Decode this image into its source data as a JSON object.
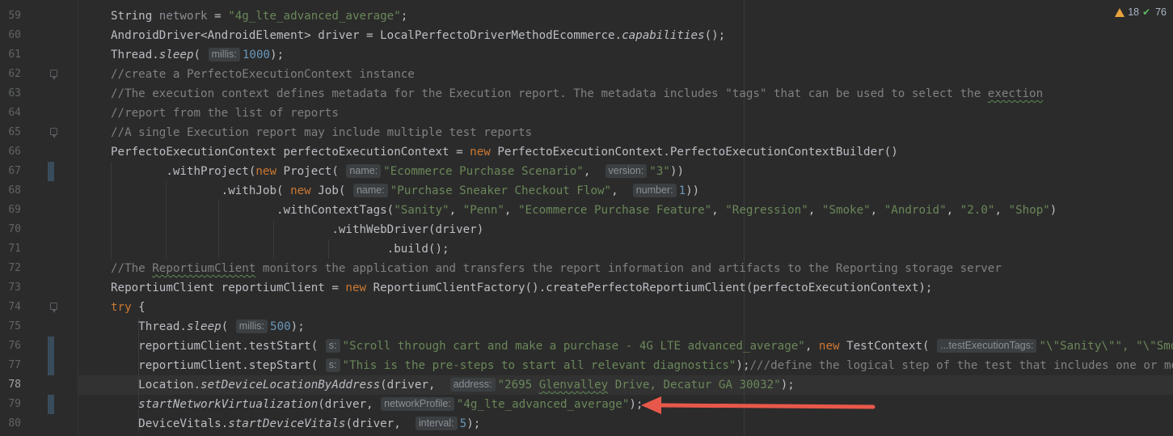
{
  "colors": {
    "keyword": "#cc7832",
    "string": "#6a8759",
    "number": "#6897bb",
    "comment": "#808080",
    "arrow": "#e8584a"
  },
  "inspections": {
    "warning_icon": "warning-triangle-icon",
    "warnings": "18",
    "check_icon": "double-check-icon",
    "passed": "76"
  },
  "current_line": 78,
  "lines": [
    {
      "n": 59,
      "tokens": [
        [
          "t",
          "String "
        ],
        [
          "dim",
          "network"
        ],
        [
          "t",
          " = "
        ],
        [
          "str",
          "\"4g_lte_advanced_average\""
        ],
        [
          "t",
          ";"
        ]
      ]
    },
    {
      "n": 60,
      "tokens": [
        [
          "t",
          "AndroidDriver<AndroidElement> driver = LocalPerfectoDriverMethodEcommerce."
        ],
        [
          "it",
          "capabilities"
        ],
        [
          "t",
          "();"
        ]
      ]
    },
    {
      "n": 61,
      "tokens": [
        [
          "t",
          "Thread."
        ],
        [
          "it",
          "sleep"
        ],
        [
          "t",
          "( "
        ],
        [
          "hint",
          "millis:"
        ],
        [
          "num",
          "1000"
        ],
        [
          "t",
          ");"
        ]
      ]
    },
    {
      "n": 62,
      "tokens": [
        [
          "cm",
          "//create a PerfectoExecutionContext instance"
        ]
      ]
    },
    {
      "n": 63,
      "tokens": [
        [
          "cm",
          "//The execution context defines metadata for the Execution report. The metadata includes \"tags\" that can be used to select the "
        ],
        [
          "cmtypo",
          "exection"
        ]
      ]
    },
    {
      "n": 64,
      "tokens": [
        [
          "cm",
          "//report from the list of reports"
        ]
      ]
    },
    {
      "n": 65,
      "tokens": [
        [
          "cm",
          "//A single Execution report may include multiple test reports"
        ]
      ]
    },
    {
      "n": 66,
      "tokens": [
        [
          "t",
          "PerfectoExecutionContext perfectoExecutionContext = "
        ],
        [
          "kw",
          "new "
        ],
        [
          "t",
          "PerfectoExecutionContext.PerfectoExecutionContextBuilder()"
        ]
      ]
    },
    {
      "n": 67,
      "tokens": [
        [
          "t",
          "        .withProject("
        ],
        [
          "kw",
          "new "
        ],
        [
          "t",
          "Project( "
        ],
        [
          "hint",
          "name:"
        ],
        [
          "str",
          "\"Ecommerce Purchase Scenario\""
        ],
        [
          "t",
          ",  "
        ],
        [
          "hint",
          "version:"
        ],
        [
          "str",
          "\"3\""
        ],
        [
          "t",
          "))"
        ]
      ]
    },
    {
      "n": 68,
      "tokens": [
        [
          "t",
          "                .withJob( "
        ],
        [
          "kw",
          "new "
        ],
        [
          "t",
          "Job( "
        ],
        [
          "hint",
          "name:"
        ],
        [
          "str",
          "\"Purchase Sneaker Checkout Flow\""
        ],
        [
          "t",
          ",  "
        ],
        [
          "hint",
          "number:"
        ],
        [
          "num",
          "1"
        ],
        [
          "t",
          "))"
        ]
      ]
    },
    {
      "n": 69,
      "tokens": [
        [
          "t",
          "                        .withContextTags("
        ],
        [
          "str",
          "\"Sanity\""
        ],
        [
          "t",
          ", "
        ],
        [
          "str",
          "\"Penn\""
        ],
        [
          "t",
          ", "
        ],
        [
          "str",
          "\"Ecommerce Purchase Feature\""
        ],
        [
          "t",
          ", "
        ],
        [
          "str",
          "\"Regression\""
        ],
        [
          "t",
          ", "
        ],
        [
          "str",
          "\"Smoke\""
        ],
        [
          "t",
          ", "
        ],
        [
          "str",
          "\"Android\""
        ],
        [
          "t",
          ", "
        ],
        [
          "str",
          "\"2.0\""
        ],
        [
          "t",
          ", "
        ],
        [
          "str",
          "\"Shop\""
        ],
        [
          "t",
          ")"
        ]
      ]
    },
    {
      "n": 70,
      "tokens": [
        [
          "t",
          "                                .withWebDriver(driver)"
        ]
      ]
    },
    {
      "n": 71,
      "tokens": [
        [
          "t",
          "                                        .build();"
        ]
      ]
    },
    {
      "n": 72,
      "tokens": [
        [
          "cm",
          "//The "
        ],
        [
          "cmtypo",
          "ReportiumClient"
        ],
        [
          "cm",
          " monitors the application and transfers the report information and artifacts to the Reporting storage server"
        ]
      ]
    },
    {
      "n": 73,
      "tokens": [
        [
          "t",
          "ReportiumClient reportiumClient = "
        ],
        [
          "kw",
          "new "
        ],
        [
          "t",
          "ReportiumClientFactory().createPerfectoReportiumClient(perfectoExecutionContext);"
        ]
      ]
    },
    {
      "n": 74,
      "tokens": [
        [
          "kw",
          "try "
        ],
        [
          "t",
          "{"
        ]
      ]
    },
    {
      "n": 75,
      "tokens": [
        [
          "t",
          "    Thread."
        ],
        [
          "it",
          "sleep"
        ],
        [
          "t",
          "( "
        ],
        [
          "hint",
          "millis:"
        ],
        [
          "num",
          "500"
        ],
        [
          "t",
          ");"
        ]
      ]
    },
    {
      "n": 76,
      "tokens": [
        [
          "t",
          "    reportiumClient.testStart( "
        ],
        [
          "hint",
          "s:"
        ],
        [
          "str",
          "\"Scroll through cart and make a purchase - 4G LTE advanced_average\""
        ],
        [
          "t",
          ", "
        ],
        [
          "kw",
          "new "
        ],
        [
          "t",
          "TestContext( "
        ],
        [
          "hint",
          "...testExecutionTags:"
        ],
        [
          "str",
          "\"\\\"Sanity\\\"\", \"\\\"Smoke\\\"\""
        ]
      ]
    },
    {
      "n": 77,
      "tokens": [
        [
          "t",
          "    reportiumClient.stepStart( "
        ],
        [
          "hint",
          "s:"
        ],
        [
          "str",
          "\"This is the pre-steps to start all relevant diagnostics\""
        ],
        [
          "t",
          ");"
        ],
        [
          "cm",
          "///define the logical step of the test that includes one or more"
        ]
      ]
    },
    {
      "n": 78,
      "tokens": [
        [
          "t",
          "    Location."
        ],
        [
          "it",
          "setDeviceLocationByAddress"
        ],
        [
          "t",
          "(driver,  "
        ],
        [
          "hint",
          "address:"
        ],
        [
          "str",
          "\"2695 "
        ],
        [
          "strtypo",
          "Glenvalley"
        ],
        [
          "str",
          " Drive, Decatur GA 30032\""
        ],
        [
          "t",
          ");"
        ]
      ]
    },
    {
      "n": 79,
      "tokens": [
        [
          "t",
          "    "
        ],
        [
          "it",
          "startNetworkVirtualization"
        ],
        [
          "t",
          "(driver, "
        ],
        [
          "hint",
          "networkProfile:"
        ],
        [
          "str",
          "\"4g_lte_advanced_average\""
        ],
        [
          "t",
          ");"
        ]
      ]
    },
    {
      "n": 80,
      "tokens": [
        [
          "t",
          "    DeviceVitals."
        ],
        [
          "it",
          "startDeviceVitals"
        ],
        [
          "t",
          "(driver,  "
        ],
        [
          "hint",
          "interval:"
        ],
        [
          "num",
          "5"
        ],
        [
          "t",
          ");"
        ]
      ]
    }
  ]
}
